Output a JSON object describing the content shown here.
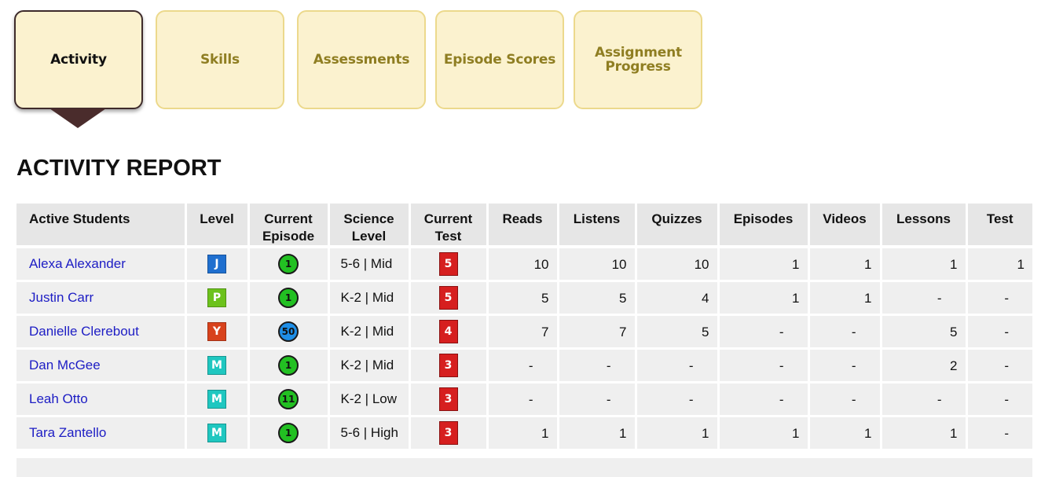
{
  "tabs": [
    {
      "label": "Activity",
      "active": true
    },
    {
      "label": "Skills",
      "active": false
    },
    {
      "label": "Assessments",
      "active": false
    },
    {
      "label": "Episode Scores",
      "active": false
    },
    {
      "label": "Assignment Progress",
      "active": false
    }
  ],
  "report_title": "ACTIVITY REPORT",
  "columns": [
    "Active Students",
    "Level",
    "Current Episode",
    "Science Level",
    "Current Test",
    "Reads",
    "Listens",
    "Quizzes",
    "Episodes",
    "Videos",
    "Lessons",
    "Test"
  ],
  "level_colors": {
    "J": "#1f6fcf",
    "P": "#6cc21c",
    "Y": "#d8421c",
    "M": "#1fc7c0"
  },
  "episode_colors": {
    "green": "#22c022",
    "blue": "#1f8fe8"
  },
  "students": [
    {
      "name": "Alexa Alexander",
      "level": "J",
      "episode": "1",
      "episode_color": "green",
      "science_level": "5-6 | Mid",
      "test": "5",
      "reads": "10",
      "listens": "10",
      "quizzes": "10",
      "episodes": "1",
      "videos": "1",
      "lessons": "1",
      "test_count": "1"
    },
    {
      "name": "Justin Carr",
      "level": "P",
      "episode": "1",
      "episode_color": "green",
      "science_level": "K-2 | Mid",
      "test": "5",
      "reads": "5",
      "listens": "5",
      "quizzes": "4",
      "episodes": "1",
      "videos": "1",
      "lessons": "-",
      "test_count": "-"
    },
    {
      "name": "Danielle Clerebout",
      "level": "Y",
      "episode": "50",
      "episode_color": "blue",
      "science_level": "K-2 | Mid",
      "test": "4",
      "reads": "7",
      "listens": "7",
      "quizzes": "5",
      "episodes": "-",
      "videos": "-",
      "lessons": "5",
      "test_count": "-"
    },
    {
      "name": "Dan McGee",
      "level": "M",
      "episode": "1",
      "episode_color": "green",
      "science_level": "K-2 | Mid",
      "test": "3",
      "reads": "-",
      "listens": "-",
      "quizzes": "-",
      "episodes": "-",
      "videos": "-",
      "lessons": "2",
      "test_count": "-"
    },
    {
      "name": "Leah Otto",
      "level": "M",
      "episode": "11",
      "episode_color": "green",
      "science_level": "K-2 | Low",
      "test": "3",
      "reads": "-",
      "listens": "-",
      "quizzes": "-",
      "episodes": "-",
      "videos": "-",
      "lessons": "-",
      "test_count": "-"
    },
    {
      "name": "Tara Zantello",
      "level": "M",
      "episode": "1",
      "episode_color": "green",
      "science_level": "5-6 | High",
      "test": "3",
      "reads": "1",
      "listens": "1",
      "quizzes": "1",
      "episodes": "1",
      "videos": "1",
      "lessons": "1",
      "test_count": "-"
    }
  ]
}
